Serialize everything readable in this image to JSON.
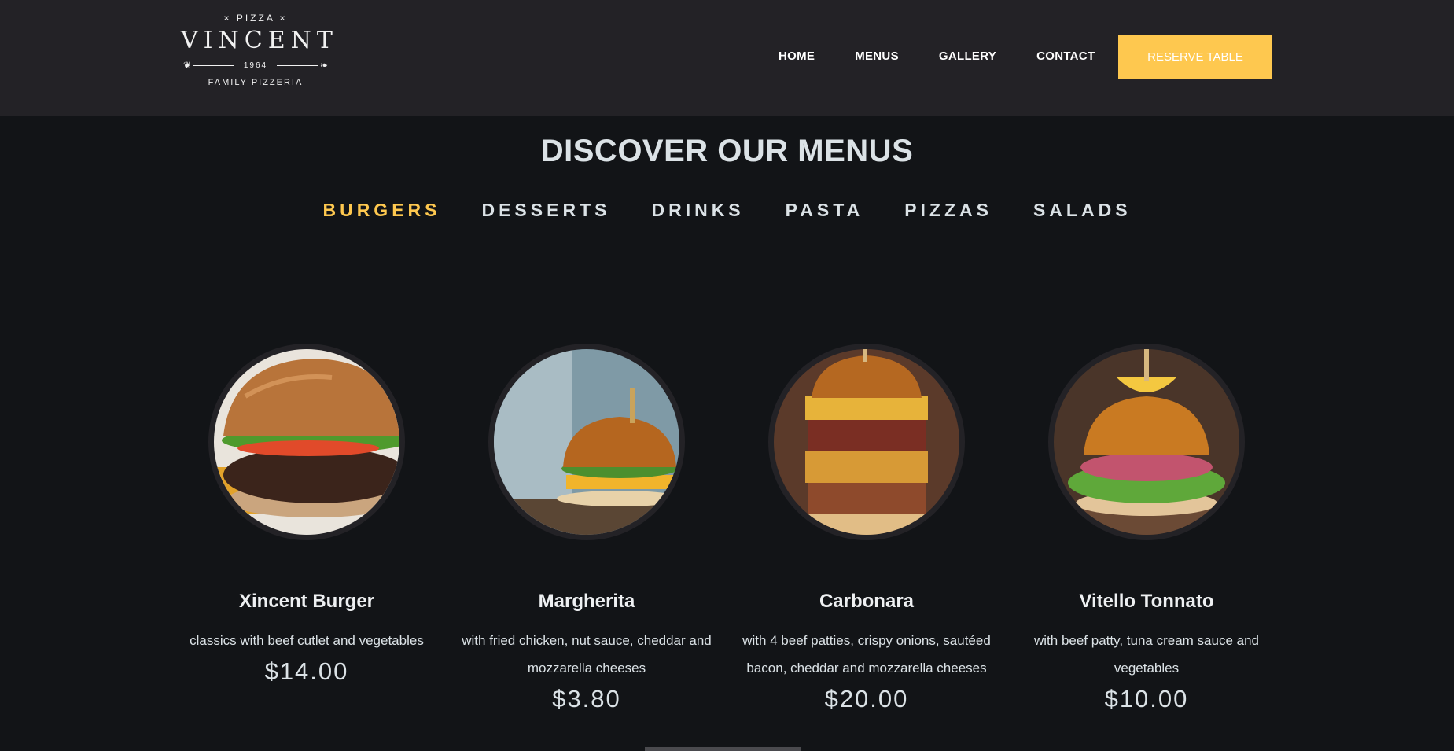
{
  "logo": {
    "top": "× PIZZA ×",
    "name": "VINCENT",
    "year": "1964",
    "tagline": "FAMILY PIZZERIA"
  },
  "nav": {
    "items": [
      "HOME",
      "MENUS",
      "GALLERY",
      "CONTACT"
    ],
    "cta": "RESERVE TABLE"
  },
  "section": {
    "title": "DISCOVER OUR MENUS"
  },
  "tabs": [
    {
      "label": "BURGERS",
      "active": true
    },
    {
      "label": "DESSERTS",
      "active": false
    },
    {
      "label": "DRINKS",
      "active": false
    },
    {
      "label": "PASTA",
      "active": false
    },
    {
      "label": "PIZZAS",
      "active": false
    },
    {
      "label": "SALADS",
      "active": false
    }
  ],
  "items": [
    {
      "name": "Xincent Burger",
      "desc": "classics with beef cutlet and vegetables",
      "price": "$14.00"
    },
    {
      "name": "Margherita",
      "desc": "with fried chicken, nut sauce, cheddar and mozzarella cheeses",
      "price": "$3.80"
    },
    {
      "name": "Carbonara",
      "desc": "with 4 beef patties, crispy onions, sautéed bacon, cheddar and mozzarella cheeses",
      "price": "$20.00"
    },
    {
      "name": "Vitello Tonnato",
      "desc": "with beef patty, tuna cream sauce and vegetables",
      "price": "$10.00"
    }
  ],
  "colors": {
    "accent": "#fec84f",
    "header_bg": "#232226",
    "page_bg": "#121417",
    "text": "#dbe2e6"
  }
}
